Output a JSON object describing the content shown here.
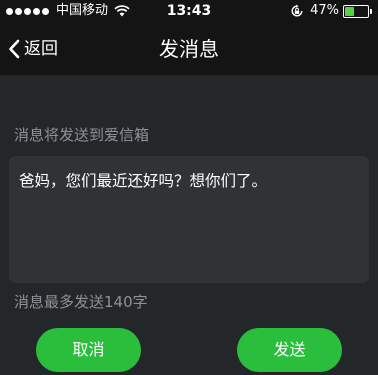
{
  "status_bar": {
    "signal_bars_filled": 5,
    "carrier": "中国移动",
    "time": "13:43",
    "battery_percent_label": "47%",
    "battery_level": 0.47,
    "icons": [
      "signal-dots-icon",
      "wifi-icon",
      "rotation-lock-icon",
      "battery-icon"
    ]
  },
  "nav": {
    "back_label": "返回",
    "title": "发消息"
  },
  "main": {
    "destination_hint": "消息将发送到爱信箱",
    "message_text": "爸妈，您们最近还好吗？想你们了。",
    "limit_hint": "消息最多发送140字"
  },
  "actions": {
    "cancel_label": "取消",
    "send_label": "发送"
  },
  "colors": {
    "background": "#24272a",
    "topbar": "#141414",
    "input_box": "#2f3336",
    "hint_text": "#8d9296",
    "accent_green": "#2bbd3c",
    "battery_green": "#5ad04a"
  }
}
